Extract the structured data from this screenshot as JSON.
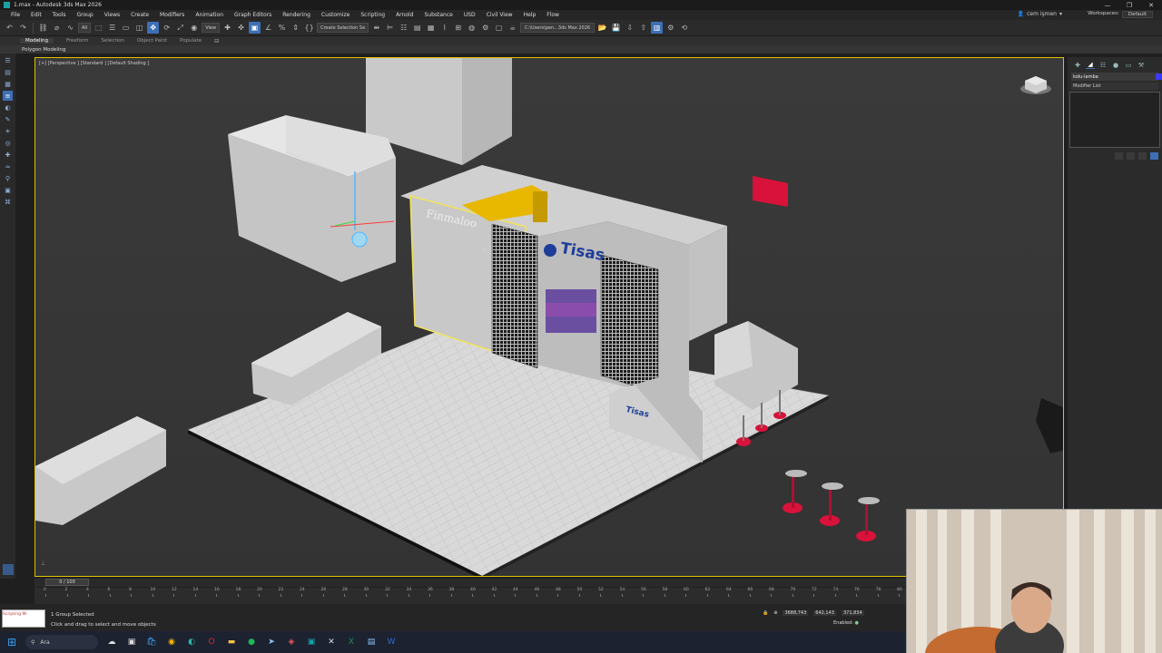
{
  "window": {
    "title": "1.max - Autodesk 3ds Max 2026",
    "controls": [
      "—",
      "❐",
      "✕"
    ]
  },
  "menubar": {
    "items": [
      "File",
      "Edit",
      "Tools",
      "Group",
      "Views",
      "Create",
      "Modifiers",
      "Animation",
      "Graph Editors",
      "Rendering",
      "Customize",
      "Scripting",
      "Arnold",
      "Substance",
      "USD",
      "Civil View",
      "Help",
      "Flow"
    ],
    "account": "cem işmen",
    "workspaces_label": "Workspaces:",
    "workspace_value": "Default"
  },
  "toolbar": {
    "filter_dropdown": "All",
    "view_dropdown": "View",
    "selection_set_dropdown": "Create Selection Se",
    "project_path": "C:\\Users\\pen...3ds Max 2026"
  },
  "ribbon": {
    "tabs": [
      "Modeling",
      "Freeform",
      "Selection",
      "Object Paint",
      "Populate"
    ],
    "subtitle": "Polygon Modeling"
  },
  "viewport": {
    "label": "[+] [Perspective ] [Standard ] [Default Shading ]",
    "booth_sign_left": "Finmaloo",
    "booth_sign_main": "Tisas",
    "booth_sign_counter": "Tisas"
  },
  "command_panel": {
    "object_name": "kolu-lamba",
    "modifier_list": "Modifier List",
    "object_color": "#3a3aff"
  },
  "timeline": {
    "frame_display": "0 / 100",
    "ticks": [
      "0",
      "2",
      "4",
      "6",
      "8",
      "10",
      "12",
      "14",
      "16",
      "18",
      "20",
      "22",
      "24",
      "26",
      "28",
      "30",
      "32",
      "34",
      "36",
      "38",
      "40",
      "42",
      "44",
      "46",
      "48",
      "50",
      "52",
      "54",
      "56",
      "58",
      "60",
      "62",
      "64",
      "66",
      "68",
      "70",
      "72",
      "74",
      "76",
      "78",
      "80"
    ]
  },
  "status": {
    "selection": "1 Group Selected",
    "prompt": "Click and drag to select and move objects",
    "script_hint": "Scripting Mi",
    "coord_x": "3688,743",
    "coord_y": "642,143",
    "coord_z": "371,834",
    "enabled_label": "Enabled:"
  },
  "taskbar": {
    "search_placeholder": "Ara"
  },
  "colors": {
    "accent_blue": "#3d6fb5",
    "viewport_border": "#e0c200",
    "selected_outline": "#f2e35a",
    "stool_red": "#d8123a"
  }
}
